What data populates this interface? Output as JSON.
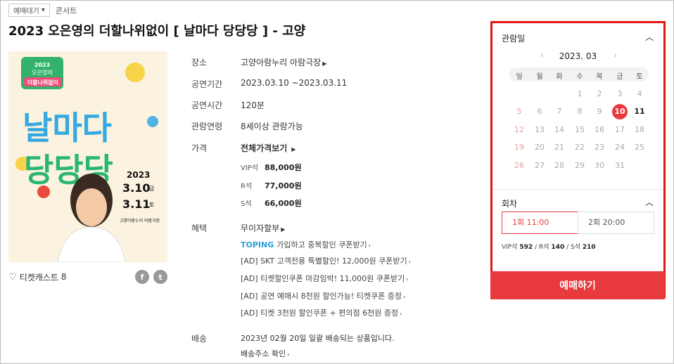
{
  "topbar": {
    "status": "예매대기",
    "status_arrow": "▾",
    "genre": "콘서트"
  },
  "title": "2023 오은영의 더할나위없이 [ 날마다 당당당 ] - 고양",
  "poster": {
    "year": "2023",
    "name1": "오은영의",
    "name2": "더할나위없이",
    "big1": "날마다",
    "big2": "당당당",
    "date1": "3.10",
    "date1_day": "금",
    "date2": "3.11",
    "date2_day": "토",
    "venue": "고양아람누리 아람극장"
  },
  "actions": {
    "cast_icon": "heart-icon",
    "cast_label": "티켓캐스트",
    "cast_count": "8",
    "facebook": "f",
    "twitter": "t"
  },
  "info": {
    "venue_label": "장소",
    "venue_value": "고양아람누리 아람극장",
    "period_label": "공연기간",
    "period_value": "2023.03.10 ~2023.03.11",
    "duration_label": "공연시간",
    "duration_value": "120분",
    "age_label": "관람연령",
    "age_value": "8세이상 관람가능",
    "price_label": "가격",
    "price_all": "전체가격보기",
    "prices": [
      {
        "grade": "VIP석",
        "amount": "88,000원"
      },
      {
        "grade": "R석",
        "amount": "77,000원"
      },
      {
        "grade": "S석",
        "amount": "66,000원"
      }
    ],
    "benefit_label": "혜택",
    "benefit_main": "무이자할부",
    "toping_logo": "TOPING",
    "benefits": [
      "가입하고 중복할인 쿠폰받기",
      "[AD] SKT 고객전용 특별할인! 12,000원 쿠폰받기",
      "[AD] 티켓할인쿠폰 마감임박! 11,000원 쿠폰받기",
      "[AD] 공연 예매시 8천원 할인가능! 티켓쿠폰 증정",
      "[AD] 티켓 3천원 할인쿠폰 + 편의점 6천원 증정"
    ],
    "delivery_label": "배송",
    "delivery_value": "2023년 02월 20일 일괄 배송되는 상품입니다.",
    "delivery_link": "배송주소 확인"
  },
  "calendar": {
    "header": "관람일",
    "month": "2023. 03",
    "prev": "‹",
    "next": "›",
    "weekdays": [
      "일",
      "월",
      "화",
      "수",
      "목",
      "금",
      "토"
    ],
    "weeks": [
      [
        "",
        "",
        "",
        "1",
        "2",
        "3",
        "4"
      ],
      [
        "5",
        "6",
        "7",
        "8",
        "9",
        "10",
        "11"
      ],
      [
        "12",
        "13",
        "14",
        "15",
        "16",
        "17",
        "18"
      ],
      [
        "19",
        "20",
        "21",
        "22",
        "23",
        "24",
        "25"
      ],
      [
        "26",
        "27",
        "28",
        "29",
        "30",
        "31",
        ""
      ]
    ],
    "selected": "10",
    "available": [
      "11"
    ]
  },
  "rounds": {
    "header": "회차",
    "items": [
      {
        "label": "1회 11:00"
      },
      {
        "label": "2회 20:00"
      }
    ],
    "seats": [
      {
        "grade": "VIP석",
        "count": "592"
      },
      {
        "grade": "R석",
        "count": "140"
      },
      {
        "grade": "S석",
        "count": "210"
      }
    ],
    "seat_sep": "/"
  },
  "book_button": "예매하기",
  "colors": {
    "accent": "#e8393d",
    "highlight": "#e01515"
  }
}
